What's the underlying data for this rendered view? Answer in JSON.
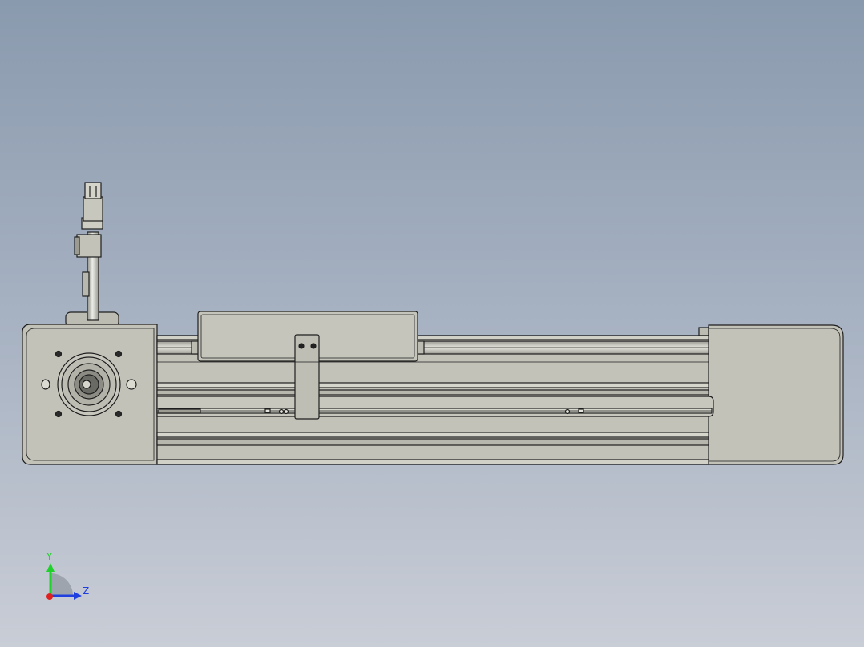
{
  "triad": {
    "y_label": "Y",
    "z_label": "Z",
    "colors": {
      "y": "#1fd12a",
      "z": "#1f3fe0",
      "x": "#e01f1f"
    }
  },
  "colors": {
    "background_top": "#8a9aae",
    "background_bottom": "#c9cdd6",
    "part_fill": "#c3c2b8",
    "part_light": "#d2d1c8",
    "edge": "#1e1e1e"
  }
}
